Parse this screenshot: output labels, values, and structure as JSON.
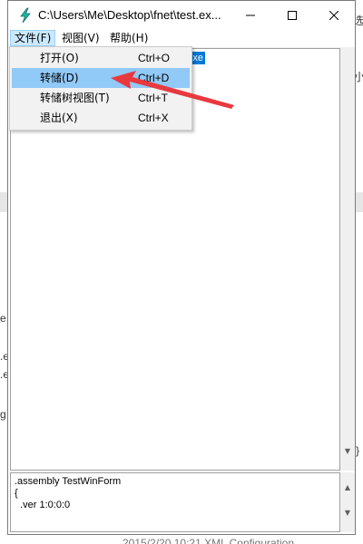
{
  "window": {
    "title": "C:\\Users\\Me\\Desktop\\fnet\\test.ex...",
    "minimize_icon": "minimize-icon",
    "maximize_icon": "maximize-icon",
    "close_icon": "close-icon"
  },
  "menubar": {
    "items": [
      {
        "label": "文件(F)"
      },
      {
        "label": "视图(V)"
      },
      {
        "label": "帮助(H)"
      }
    ]
  },
  "file_menu": {
    "items": [
      {
        "label": "打开(O)",
        "shortcut": "Ctrl+O"
      },
      {
        "label": "转储(D)",
        "shortcut": "Ctrl+D"
      },
      {
        "label": "转储树视图(T)",
        "shortcut": "Ctrl+T"
      },
      {
        "label": "退出(X)",
        "shortcut": "Ctrl+X"
      }
    ],
    "highlighted_index": 1
  },
  "tree": {
    "selected_node_fragment": "xe"
  },
  "info_panel": {
    "text": ".assembly TestWinForm\n{\n  .ver 1:0:0:0"
  },
  "background": {
    "chars": [
      {
        "text": "选"
      },
      {
        "text": "小"
      },
      {
        "text": "e"
      },
      {
        "text": ".e"
      },
      {
        "text": ".e"
      },
      {
        "text": "g"
      },
      {
        "text": "}"
      }
    ],
    "bottom_text": "2015/2/20 10:21      XML Configuration"
  },
  "colors": {
    "menu_hover": "#91c9f7",
    "selection": "#0078d7",
    "annotation_arrow": "#e8393f",
    "app_icon": "#1fb5a8"
  }
}
